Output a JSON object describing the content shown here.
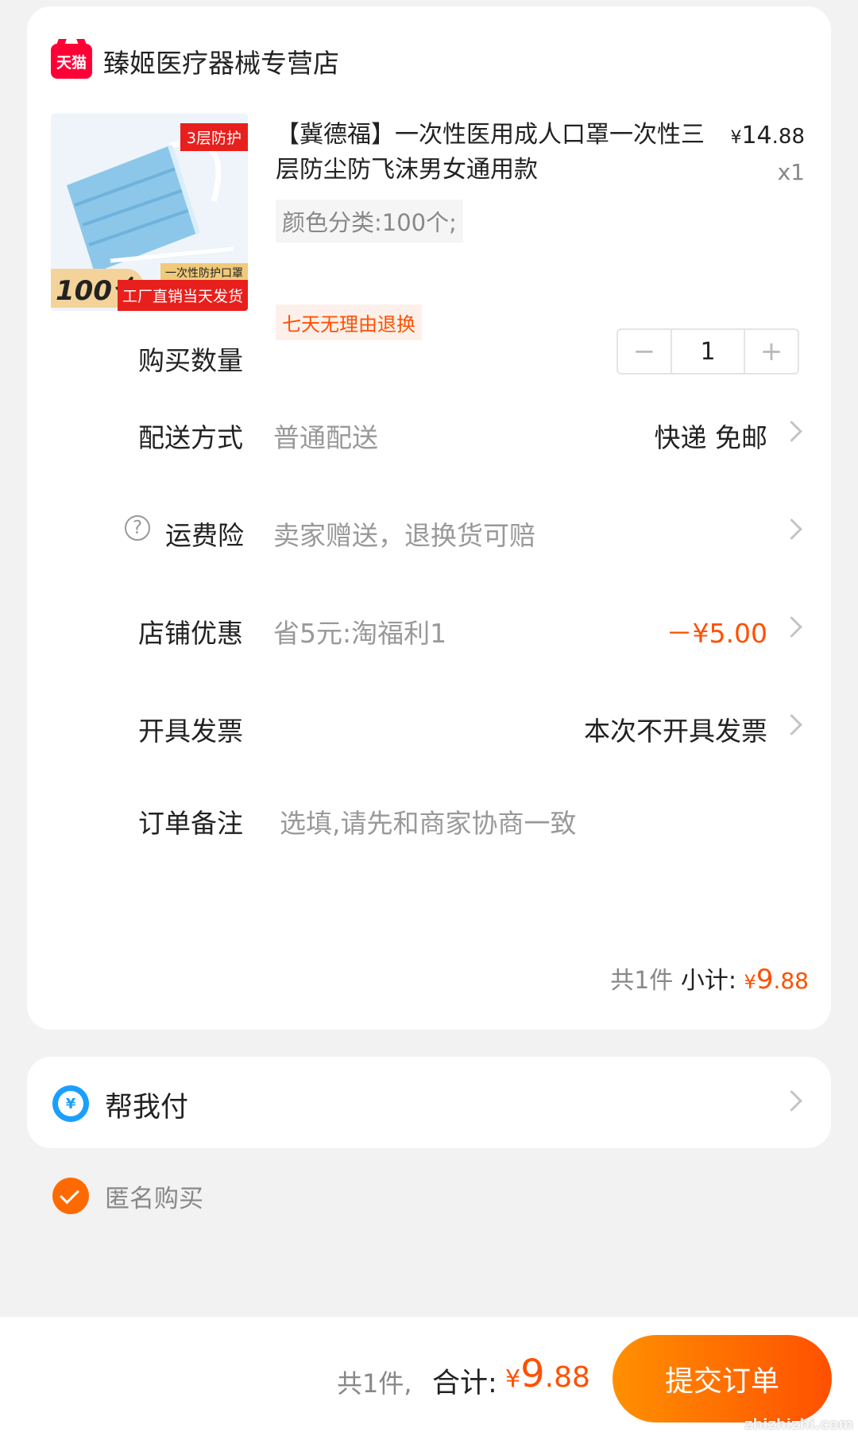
{
  "store": {
    "logo_text": "天猫",
    "name": "臻姬医疗器械专营店"
  },
  "product": {
    "thumb": {
      "tag": "3层防护",
      "count": "100个",
      "sub": "一次性防护口罩",
      "slogan": "工厂直销当天发货"
    },
    "title": "【冀德福】一次性医用成人口罩一次性三层防尘防飞沫男女通用款",
    "price_currency": "¥",
    "price_int": "14",
    "price_dec": ".88",
    "quantity": "x1",
    "sku": "颜色分类:100个;",
    "return_tag": "七天无理由退换"
  },
  "rows": {
    "quantity": {
      "label": "购买数量",
      "minus": "−",
      "value": "1",
      "plus": "+"
    },
    "delivery": {
      "label": "配送方式",
      "desc": "普通配送",
      "value": "快递 免邮"
    },
    "insurance": {
      "icon": "?",
      "label": "运费险",
      "desc": "卖家赠送，退换货可赔"
    },
    "discount": {
      "label": "店铺优惠",
      "desc": "省5元:淘福利1",
      "value": "－¥5.00"
    },
    "invoice": {
      "label": "开具发票",
      "value": "本次不开具发票"
    },
    "note": {
      "label": "订单备注",
      "placeholder": "选填,请先和商家协商一致"
    }
  },
  "subtotal": {
    "count": "共1件",
    "label": "小计:",
    "currency": "¥",
    "int": "9",
    "dec": ".88"
  },
  "pay_for_me": {
    "icon_char": "¥",
    "label": "帮我付"
  },
  "anonymous": {
    "label": "匿名购买",
    "checked": true
  },
  "footer": {
    "count": "共1件,",
    "label": "合计:",
    "currency": "¥",
    "int": "9",
    "dec": ".88",
    "submit": "提交订单",
    "watermark": "zhizhizhi.com"
  },
  "colors": {
    "accent": "#ff5000",
    "tmall_red": "#ff0036",
    "pay_blue": "#1a9fff"
  }
}
